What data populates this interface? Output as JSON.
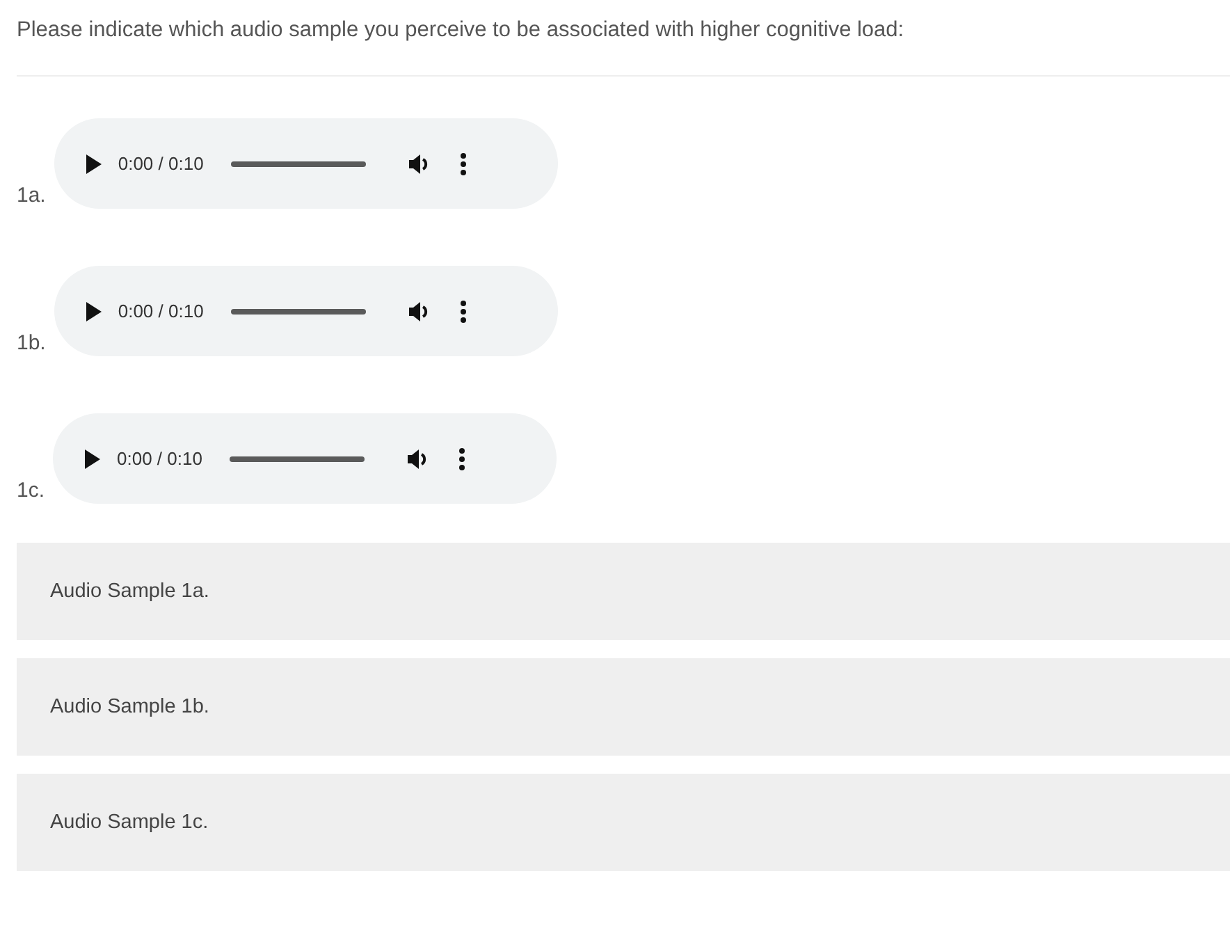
{
  "question": "Please indicate which audio sample you perceive to be associated with higher cognitive load:",
  "players": [
    {
      "label": "1a.",
      "time": "0:00 / 0:10"
    },
    {
      "label": "1b.",
      "time": "0:00 / 0:10"
    },
    {
      "label": "1c.",
      "time": "0:00 / 0:10"
    }
  ],
  "options": [
    {
      "label": "Audio Sample 1a.",
      "selected": false
    },
    {
      "label": "Audio Sample 1b.",
      "selected": false
    },
    {
      "label": "Audio Sample 1c.",
      "selected": false
    }
  ]
}
